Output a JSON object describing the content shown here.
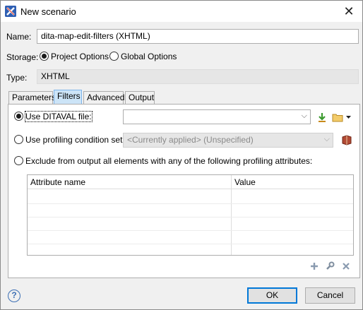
{
  "window": {
    "title": "New scenario",
    "app_icon": "oxygen-app-icon",
    "close_glyph": "✕"
  },
  "name": {
    "label": "Name:",
    "value": "dita-map-edit-filters (XHTML)"
  },
  "storage": {
    "label": "Storage:",
    "options": [
      {
        "label": "Project Options",
        "selected": true
      },
      {
        "label": "Global Options",
        "selected": false
      }
    ]
  },
  "type": {
    "label": "Type:",
    "value": "XHTML"
  },
  "tabs": [
    {
      "label": "Parameters",
      "active": false
    },
    {
      "label": "Filters",
      "active": true
    },
    {
      "label": "Advanced",
      "active": false
    },
    {
      "label": "Output",
      "active": false
    }
  ],
  "filters": {
    "ditaval": {
      "label": "Use DITAVAL file:",
      "selected": true,
      "value": ""
    },
    "profiling": {
      "label": "Use profiling condition set:",
      "selected": false,
      "value": "<Currently applied> (Unspecified)"
    },
    "exclude": {
      "label": "Exclude from output all elements with any of the following profiling attributes:",
      "selected": false
    },
    "table": {
      "columns": [
        "Attribute name",
        "Value"
      ],
      "rows": []
    },
    "icons": {
      "download": "download-icon",
      "folder": "folder-icon",
      "book": "book-icon",
      "add": "add-icon",
      "edit": "wrench-icon",
      "remove": "remove-icon"
    }
  },
  "footer": {
    "help_glyph": "?",
    "ok_label": "OK",
    "cancel_label": "Cancel"
  },
  "colors": {
    "active_tab": "#cce4f7",
    "accent": "#0078d7",
    "download_green": "#3b9a2e",
    "folder_yellow": "#e8b84a",
    "book_red": "#a23b2a"
  }
}
